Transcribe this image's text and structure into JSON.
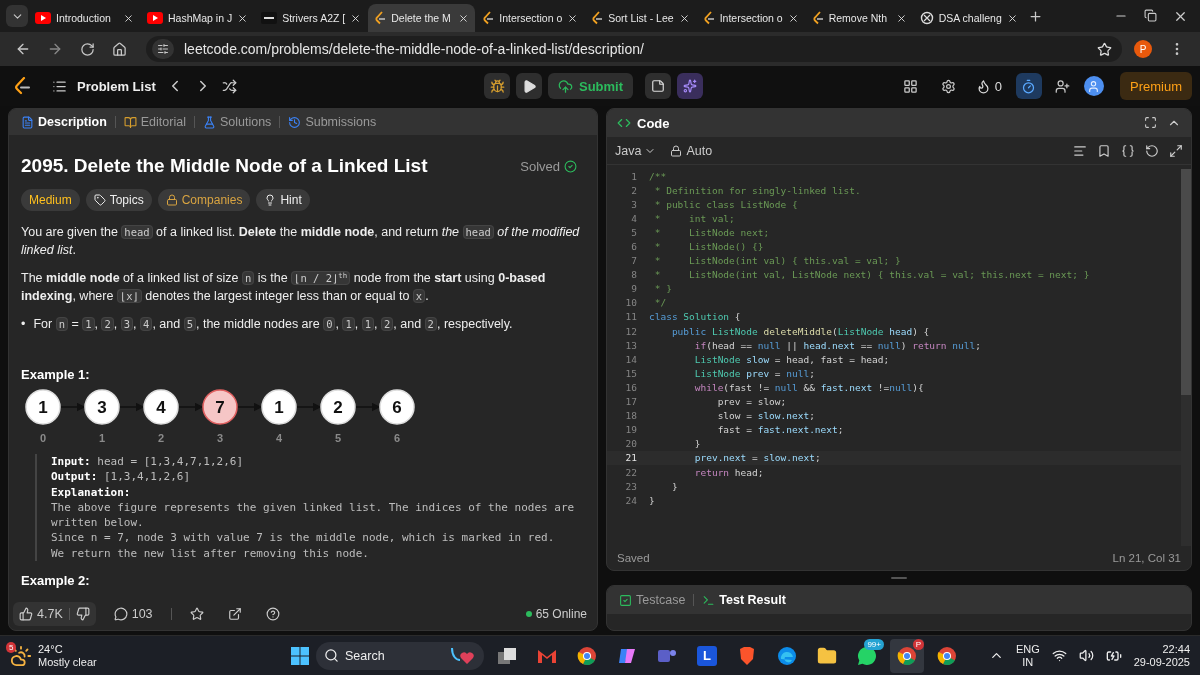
{
  "browser": {
    "tabs": [
      {
        "title": "Introduction",
        "kind": "video",
        "selected": false
      },
      {
        "title": "HashMap in J",
        "kind": "video",
        "selected": false
      },
      {
        "title": "Strivers A2Z [",
        "kind": "course",
        "selected": false
      },
      {
        "title": "Delete the M",
        "kind": "problem",
        "selected": true
      },
      {
        "title": "Intersection o",
        "kind": "problem",
        "selected": false
      },
      {
        "title": "Sort List - Lee",
        "kind": "problem",
        "selected": false
      },
      {
        "title": "Intersection o",
        "kind": "problem",
        "selected": false
      },
      {
        "title": "Remove Nth",
        "kind": "problem",
        "selected": false
      },
      {
        "title": "DSA challeng",
        "kind": "chat",
        "selected": false
      }
    ],
    "url": "leetcode.com/problems/delete-the-middle-node-of-a-linked-list/description/",
    "profile": "P"
  },
  "topbar": {
    "problem_list": "Problem List",
    "submit": "Submit",
    "streak": "0",
    "premium": "Premium"
  },
  "description_panel": {
    "tabs": [
      {
        "label": "Description",
        "kind": "document",
        "selected": true
      },
      {
        "label": "Editorial",
        "kind": "book",
        "selected": false
      },
      {
        "label": "Solutions",
        "kind": "flask",
        "selected": false
      },
      {
        "label": "Submissions",
        "kind": "history",
        "selected": false
      }
    ],
    "title": "2095. Delete the Middle Node of a Linked List",
    "status": "Solved",
    "tags": [
      {
        "label": "Medium",
        "kind": "difficulty"
      },
      {
        "label": "Topics",
        "kind": "topics"
      },
      {
        "label": "Companies",
        "kind": "companies"
      },
      {
        "label": "Hint",
        "kind": "hint"
      }
    ],
    "paragraphs": [
      [
        {
          "kind": "text",
          "text": "You are given the "
        },
        {
          "kind": "code",
          "text": "head"
        },
        {
          "kind": "text",
          "text": " of a linked list. **Delete** the **middle node**, and return *the* "
        },
        {
          "kind": "code",
          "text": "head"
        },
        {
          "kind": "text",
          "text": " *of the modified linked list*."
        }
      ],
      [
        {
          "kind": "text",
          "text": "The **middle node** of a linked list of size "
        },
        {
          "kind": "code",
          "text": "n"
        },
        {
          "kind": "text",
          "text": " is the "
        },
        {
          "kind": "code",
          "text": "⌊n / 2⌋$^{th}$"
        },
        {
          "kind": "text",
          "text": " node from the **start** using **0-based indexing**, where "
        },
        {
          "kind": "code",
          "text": "⌊x⌋"
        },
        {
          "kind": "text",
          "text": " denotes the largest integer less than or equal to "
        },
        {
          "kind": "code",
          "text": "x"
        },
        {
          "kind": "text",
          "text": "."
        }
      ]
    ],
    "bullets": [
      {
        "marker": "•",
        "segments": [
          {
            "kind": "text",
            "text": "For "
          },
          {
            "kind": "code",
            "text": "n"
          },
          {
            "kind": "text",
            "text": " = "
          },
          {
            "kind": "code",
            "text": "1"
          },
          {
            "kind": "text",
            "text": ", "
          },
          {
            "kind": "code",
            "text": "2"
          },
          {
            "kind": "text",
            "text": ", "
          },
          {
            "kind": "code",
            "text": "3"
          },
          {
            "kind": "text",
            "text": ", "
          },
          {
            "kind": "code",
            "text": "4"
          },
          {
            "kind": "text",
            "text": ", and "
          },
          {
            "kind": "code",
            "text": "5"
          },
          {
            "kind": "text",
            "text": ", the middle nodes are "
          },
          {
            "kind": "code",
            "text": "0"
          },
          {
            "kind": "text",
            "text": ", "
          },
          {
            "kind": "code",
            "text": "1"
          },
          {
            "kind": "text",
            "text": ", "
          },
          {
            "kind": "code",
            "text": "1"
          },
          {
            "kind": "text",
            "text": ", "
          },
          {
            "kind": "code",
            "text": "2"
          },
          {
            "kind": "text",
            "text": ", and "
          },
          {
            "kind": "code",
            "text": "2"
          },
          {
            "kind": "text",
            "text": ", respectively."
          }
        ]
      }
    ],
    "example1": {
      "heading": "Example 1:",
      "nodes": [
        {
          "value": "1",
          "index": "0",
          "highlighted": false
        },
        {
          "value": "3",
          "index": "1",
          "highlighted": false
        },
        {
          "value": "4",
          "index": "2",
          "highlighted": false
        },
        {
          "value": "7",
          "index": "3",
          "highlighted": true
        },
        {
          "value": "1",
          "index": "4",
          "highlighted": false
        },
        {
          "value": "2",
          "index": "5",
          "highlighted": false
        },
        {
          "value": "6",
          "index": "6",
          "highlighted": false
        }
      ],
      "lines": [
        {
          "label": "Input:",
          "value": "head = [1,3,4,7,1,2,6]"
        },
        {
          "label": "Output:",
          "value": "[1,3,4,1,2,6]"
        },
        {
          "label": "Explanation:"
        }
      ],
      "explanation": [
        "The above figure represents the given linked list. The indices of the nodes are written below.",
        "Since n = 7, node 3 with value 7 is the middle node, which is marked in red.",
        "We return the new list after removing this node."
      ]
    },
    "example2_heading": "Example 2:",
    "footer": {
      "likes": "4.7K",
      "comments": "103",
      "online": "65 Online"
    }
  },
  "code_panel": {
    "title": "Code",
    "language": "Java",
    "mode": "Auto",
    "lines": [
      {
        "number": "1",
        "current": false,
        "tokens": [
          {
            "text": "/**",
            "kind": "comment"
          }
        ]
      },
      {
        "number": "2",
        "current": false,
        "tokens": [
          {
            "text": " * Definition for singly-linked list.",
            "kind": "comment"
          }
        ]
      },
      {
        "number": "3",
        "current": false,
        "tokens": [
          {
            "text": " * public class ListNode {",
            "kind": "comment"
          }
        ]
      },
      {
        "number": "4",
        "current": false,
        "tokens": [
          {
            "text": " *     int val;",
            "kind": "comment"
          }
        ]
      },
      {
        "number": "5",
        "current": false,
        "tokens": [
          {
            "text": " *     ListNode next;",
            "kind": "comment"
          }
        ]
      },
      {
        "number": "6",
        "current": false,
        "tokens": [
          {
            "text": " *     ListNode() {}",
            "kind": "comment"
          }
        ]
      },
      {
        "number": "7",
        "current": false,
        "tokens": [
          {
            "text": " *     ListNode(int val) { this.val = val; }",
            "kind": "comment"
          }
        ]
      },
      {
        "number": "8",
        "current": false,
        "tokens": [
          {
            "text": " *     ListNode(int val, ListNode next) { this.val = val; this.next = next; }",
            "kind": "comment"
          }
        ]
      },
      {
        "number": "9",
        "current": false,
        "tokens": [
          {
            "text": " * }",
            "kind": "comment"
          }
        ]
      },
      {
        "number": "10",
        "current": false,
        "tokens": [
          {
            "text": " */",
            "kind": "comment"
          }
        ]
      },
      {
        "number": "11",
        "current": false,
        "tokens": [
          {
            "text": "class ",
            "kind": "storage"
          },
          {
            "text": "Solution",
            "kind": "type"
          },
          {
            "text": " {",
            "kind": "plain"
          }
        ]
      },
      {
        "number": "12",
        "current": false,
        "tokens": [
          {
            "text": "    public ",
            "kind": "storage"
          },
          {
            "text": "ListNode ",
            "kind": "type"
          },
          {
            "text": "deleteMiddle",
            "kind": "function"
          },
          {
            "text": "(",
            "kind": "plain"
          },
          {
            "text": "ListNode ",
            "kind": "type"
          },
          {
            "text": "head",
            "kind": "variable"
          },
          {
            "text": ") {",
            "kind": "plain"
          }
        ]
      },
      {
        "number": "13",
        "current": false,
        "tokens": [
          {
            "text": "        if",
            "kind": "keyword"
          },
          {
            "text": "(head == ",
            "kind": "plain"
          },
          {
            "text": "null",
            "kind": "storage"
          },
          {
            "text": " || ",
            "kind": "plain"
          },
          {
            "text": "head.next",
            "kind": "variable"
          },
          {
            "text": " == ",
            "kind": "plain"
          },
          {
            "text": "null",
            "kind": "storage"
          },
          {
            "text": ") ",
            "kind": "plain"
          },
          {
            "text": "return ",
            "kind": "keyword"
          },
          {
            "text": "null",
            "kind": "storage"
          },
          {
            "text": ";",
            "kind": "plain"
          }
        ]
      },
      {
        "number": "14",
        "current": false,
        "tokens": [
          {
            "text": "        ListNode",
            "kind": "type"
          },
          {
            "text": " slow",
            "kind": "variable"
          },
          {
            "text": " = head, fast = head;",
            "kind": "plain"
          }
        ]
      },
      {
        "number": "15",
        "current": false,
        "tokens": [
          {
            "text": "        ListNode",
            "kind": "type"
          },
          {
            "text": " prev",
            "kind": "variable"
          },
          {
            "text": " = ",
            "kind": "plain"
          },
          {
            "text": "null",
            "kind": "storage"
          },
          {
            "text": ";",
            "kind": "plain"
          }
        ]
      },
      {
        "number": "16",
        "current": false,
        "tokens": [
          {
            "text": "        while",
            "kind": "keyword"
          },
          {
            "text": "(fast != ",
            "kind": "plain"
          },
          {
            "text": "null",
            "kind": "storage"
          },
          {
            "text": " && ",
            "kind": "plain"
          },
          {
            "text": "fast.next",
            "kind": "variable"
          },
          {
            "text": " !=",
            "kind": "plain"
          },
          {
            "text": "null",
            "kind": "storage"
          },
          {
            "text": "){",
            "kind": "plain"
          }
        ]
      },
      {
        "number": "17",
        "current": false,
        "tokens": [
          {
            "text": "            prev = slow;",
            "kind": "plain"
          }
        ]
      },
      {
        "number": "18",
        "current": false,
        "tokens": [
          {
            "text": "            slow = ",
            "kind": "plain"
          },
          {
            "text": "slow.next",
            "kind": "variable"
          },
          {
            "text": ";",
            "kind": "plain"
          }
        ]
      },
      {
        "number": "19",
        "current": false,
        "tokens": [
          {
            "text": "            fast = ",
            "kind": "plain"
          },
          {
            "text": "fast.next.next",
            "kind": "variable"
          },
          {
            "text": ";",
            "kind": "plain"
          }
        ]
      },
      {
        "number": "20",
        "current": false,
        "tokens": [
          {
            "text": "        }",
            "kind": "plain"
          }
        ]
      },
      {
        "number": "21",
        "current": true,
        "tokens": [
          {
            "text": "        prev.next",
            "kind": "variable"
          },
          {
            "text": " = ",
            "kind": "plain"
          },
          {
            "text": "slow.next",
            "kind": "variable"
          },
          {
            "text": ";",
            "kind": "plain"
          }
        ]
      },
      {
        "number": "22",
        "current": false,
        "tokens": [
          {
            "text": "        return",
            "kind": "keyword"
          },
          {
            "text": " head;",
            "kind": "plain"
          }
        ]
      },
      {
        "number": "23",
        "current": false,
        "tokens": [
          {
            "text": "    }",
            "kind": "plain"
          }
        ]
      },
      {
        "number": "24",
        "current": false,
        "tokens": [
          {
            "text": "}",
            "kind": "plain"
          }
        ]
      }
    ],
    "status": "Saved",
    "cursor": "Ln 21, Col 31"
  },
  "bottom_panel": {
    "tabs": [
      {
        "label": "Testcase",
        "kind": "check",
        "selected": false
      },
      {
        "label": "Test Result",
        "kind": "terminal",
        "selected": true
      }
    ]
  },
  "taskbar": {
    "weather": {
      "badge": "5",
      "temperature": "24°C",
      "condition": "Mostly clear"
    },
    "search": "Search",
    "apps": [
      {
        "kind": "files",
        "selected": false
      },
      {
        "kind": "mail",
        "selected": false
      },
      {
        "kind": "chrome",
        "selected": false
      },
      {
        "kind": "copilot",
        "selected": false
      },
      {
        "kind": "teams",
        "selected": false
      },
      {
        "kind": "letter",
        "label": "L",
        "selected": false
      },
      {
        "kind": "brave",
        "selected": false
      },
      {
        "kind": "edge",
        "selected": false
      },
      {
        "kind": "folder",
        "selected": false
      },
      {
        "kind": "chat",
        "badge": "99+",
        "selected": false
      },
      {
        "kind": "chrome",
        "badge": "P",
        "selected": true
      },
      {
        "kind": "chrome",
        "selected": false
      }
    ],
    "language": "ENG",
    "region": "IN",
    "time": "22:44",
    "date": "29-09-2025"
  }
}
